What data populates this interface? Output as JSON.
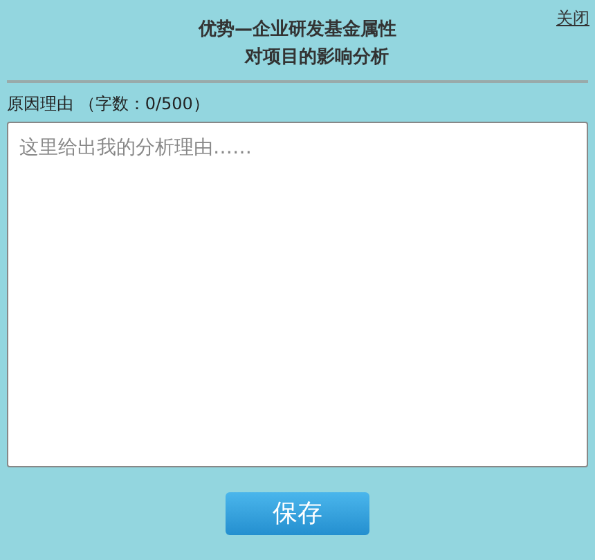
{
  "close_link": "关闭",
  "title_lines": [
    "优势—企业研发基金属性",
    "对项目的影响分析"
  ],
  "reason_label": "原因理由 （字数：0/500）",
  "reason_field": {
    "placeholder": "这里给出我的分析理由……"
  },
  "save_button": "保存"
}
